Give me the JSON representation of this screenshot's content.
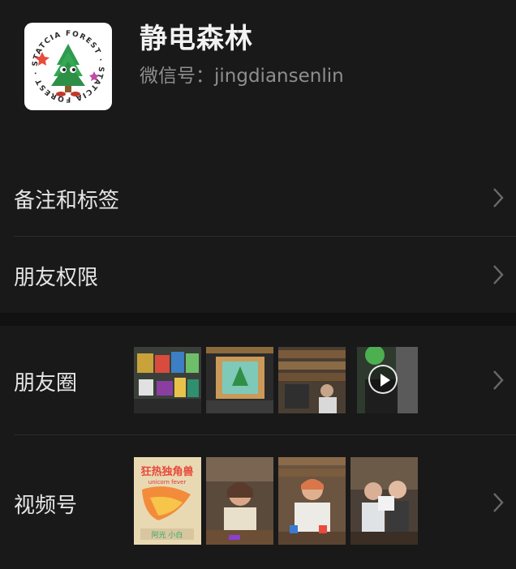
{
  "profile": {
    "name": "静电森林",
    "wechat_id_label": "微信号：jingdiansenlin",
    "avatar_logo_text": "STATCIA FOREST · STATCIA FOREST"
  },
  "menu": {
    "remarks_tags": "备注和标签",
    "friend_permissions": "朋友权限",
    "moments": "朋友圈",
    "channels": "视频号"
  },
  "channels_thumb_text": {
    "title": "狂热独角兽",
    "subtitle": "unicorn fever",
    "names": "阿光 小白"
  },
  "icons": {
    "chevron": "chevron-right-icon",
    "play": "play-icon"
  },
  "colors": {
    "background": "#191919",
    "section_gap": "#111111",
    "text_primary": "#e6e6e6",
    "text_secondary": "#8e8e8e",
    "chevron": "#6a6a6a"
  }
}
